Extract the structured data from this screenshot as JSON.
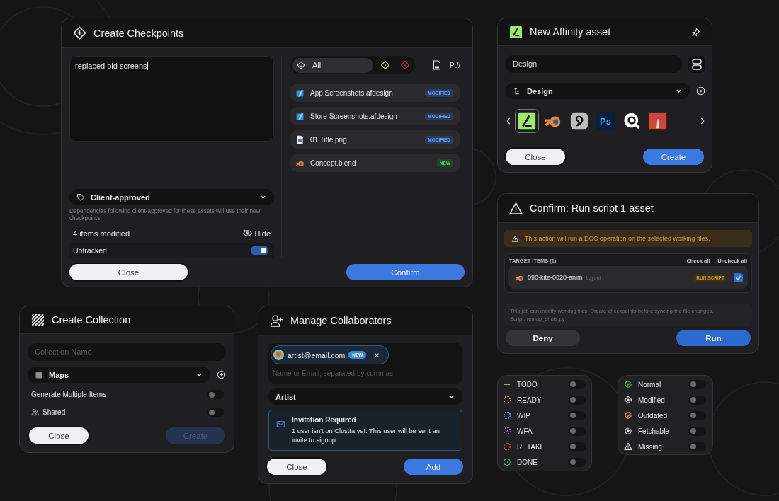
{
  "checkpoints": {
    "title": "Create Checkpoints",
    "message": "replaced old screens",
    "filters": [
      {
        "kind": "all",
        "label": "All",
        "selected": true
      },
      {
        "kind": "diamond",
        "color": "#b5b830",
        "selected": false
      },
      {
        "kind": "diamond",
        "color": "#a0283a",
        "selected": false
      }
    ],
    "path_label": "P://",
    "files": [
      {
        "kind": "affinity",
        "name": "App Screenshots.afdesign",
        "badge": "MODIFIED",
        "color": "#263d60"
      },
      {
        "kind": "affinity",
        "name": "Store Screenshots.afdesign",
        "badge": "MODIFIED",
        "color": "#263d60"
      },
      {
        "kind": "image",
        "name": "01 Title.png",
        "badge": "MODIFIED",
        "color": "#263d60"
      },
      {
        "kind": "blender",
        "name": "Concept.blend",
        "badge": "NEW",
        "color": "#1f4228"
      }
    ],
    "tag": "Client-approved",
    "hint": "Dependencies following client-approved for these assets will use their new checkpoints.",
    "count": "4 items modified",
    "hide": "Hide",
    "untracked": {
      "label": "Untracked",
      "on": true
    },
    "buttons": {
      "close": "Close",
      "confirm": "Confirm"
    }
  },
  "affinity": {
    "title": "New Affinity asset",
    "name_value": "Design",
    "type": "Design",
    "apps": [
      {
        "kind": "affinity",
        "selected": true
      },
      {
        "kind": "blender",
        "selected": false
      },
      {
        "kind": "swirl",
        "selected": false
      },
      {
        "kind": "ps",
        "label": "Ps",
        "selected": false
      },
      {
        "kind": "ring",
        "selected": false
      },
      {
        "kind": "pencil",
        "selected": false
      }
    ],
    "buttons": {
      "close": "Close",
      "create": "Create"
    }
  },
  "confirm": {
    "title": "Confirm: Run script 1 asset",
    "warning": "This action will run a DCC operation on the selected working files.",
    "target_heading": "TARGET ITEMS (1)",
    "check_all": "Check all",
    "uncheck_all": "Uncheck all",
    "items": [
      {
        "name": "090-kite-0020-anim",
        "task": "Layout",
        "badge": "RUN SCRIPT",
        "checked": true
      }
    ],
    "note": "This job can modify working files. Create checkpoints before syncing the file changes.",
    "script": "Script: remap_shots.py",
    "buttons": {
      "deny": "Deny",
      "run": "Run"
    }
  },
  "collection": {
    "title": "Create Collection",
    "name_placeholder": "Collection Name",
    "type": "Maps",
    "options": [
      {
        "kind": "plain",
        "label": "Generate Multiple Items",
        "on": false
      },
      {
        "kind": "users",
        "label": "Shared",
        "on": false
      }
    ],
    "buttons": {
      "close": "Close",
      "create": "Create"
    },
    "create_disabled": true
  },
  "collaborators": {
    "title": "Manage Collaborators",
    "chip": "artist@email.com",
    "chip_badge": "NEW",
    "placeholder": "Name or Email, separated by commas",
    "role": "Artist",
    "notice_title": "Invitation Required",
    "notice_text": "1 user isn't on Clustta yet. This user will be sent an invite to signup.",
    "buttons": {
      "close": "Close",
      "add": "Add"
    }
  },
  "statuses": [
    {
      "kind": "dash",
      "label": "TODO",
      "color": "#9a9a9a",
      "on": false
    },
    {
      "kind": "dashed",
      "label": "READY",
      "color": "#d08a2b",
      "on": false
    },
    {
      "kind": "dashed",
      "label": "WIP",
      "color": "#5a6fe0",
      "on": false
    },
    {
      "kind": "dashed-check",
      "label": "WFA",
      "color": "#9a5ad8",
      "on": false
    },
    {
      "kind": "partial",
      "label": "RETAKE",
      "color": "#c0303a",
      "on": false
    },
    {
      "kind": "check",
      "label": "DONE",
      "color": "#3db34a",
      "on": false
    }
  ],
  "states": [
    {
      "kind": "normal",
      "label": "Normal",
      "on": false
    },
    {
      "kind": "modified",
      "label": "Modified",
      "on": false
    },
    {
      "kind": "outdated",
      "label": "Outdated",
      "on": false
    },
    {
      "kind": "fetchable",
      "label": "Fetchable",
      "on": false
    },
    {
      "kind": "missing",
      "label": "Missing",
      "on": false
    }
  ]
}
